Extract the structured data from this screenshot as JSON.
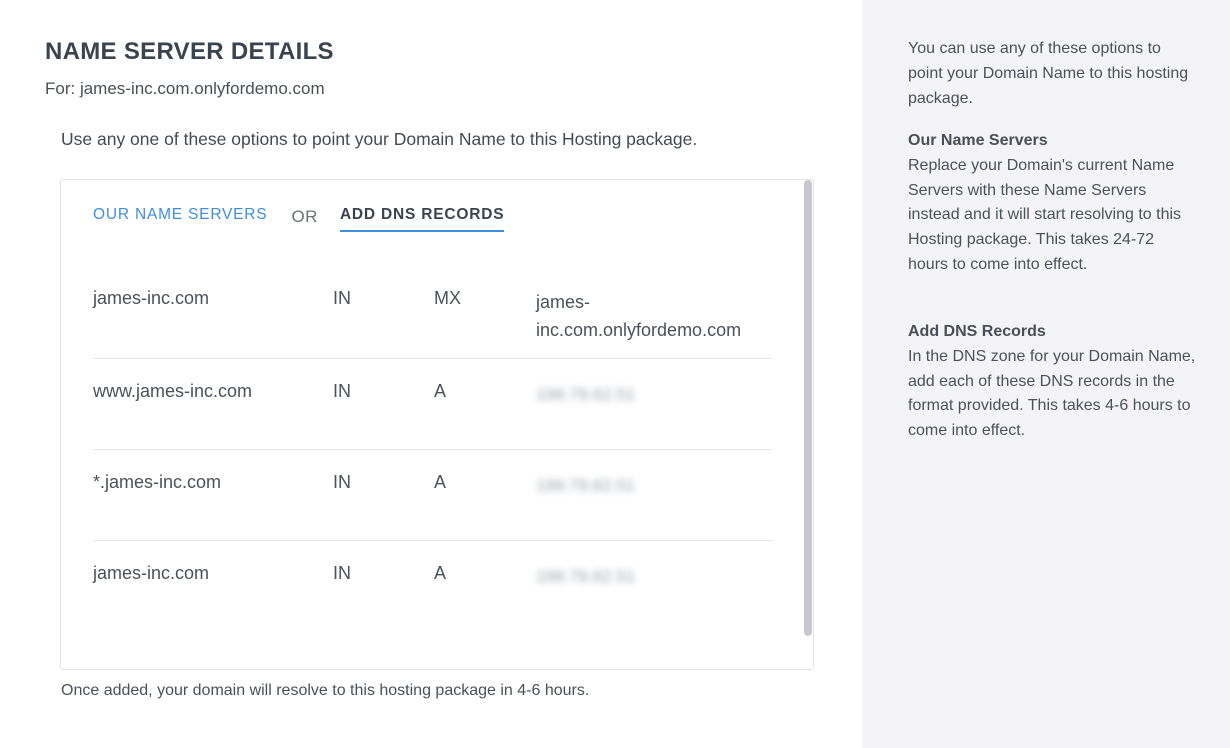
{
  "header": {
    "title": "NAME SERVER DETAILS",
    "subtitle": "For: james-inc.com.onlyfordemo.com"
  },
  "intro": "Use any one of these options to point your Domain Name to this Hosting package.",
  "tabs": {
    "name_servers": "OUR NAME SERVERS",
    "separator": "OR",
    "dns_records": "ADD DNS RECORDS"
  },
  "records": [
    {
      "host": "james-inc.com",
      "class": "IN",
      "type": "MX",
      "value": "james-inc.com.onlyfordemo.com"
    },
    {
      "host": "www.james-inc.com",
      "class": "IN",
      "type": "A",
      "value": "199.79.62.51"
    },
    {
      "host": "*.james-inc.com",
      "class": "IN",
      "type": "A",
      "value": "199.79.62.51"
    },
    {
      "host": "james-inc.com",
      "class": "IN",
      "type": "A",
      "value": "199.79.62.51"
    }
  ],
  "footnote": "Once added, your domain will resolve to this hosting package in 4-6 hours.",
  "sidebar": {
    "intro": "You can use any of these options to point your Domain Name to this hosting package.",
    "name_servers_title": "Our Name Servers",
    "name_servers_text": "Replace your Domain's current Name Servers with these Name Servers instead and it will start resolving to this Hosting package. This takes 24-72 hours to come into effect.",
    "dns_title": "Add DNS Records",
    "dns_text": "In the DNS zone for your Domain Name, add each of these DNS records in the format provided. This takes 4-6 hours to come into effect."
  },
  "colors": {
    "accent": "#3d8ee0",
    "sidebar_bg": "#f4f4f6"
  }
}
